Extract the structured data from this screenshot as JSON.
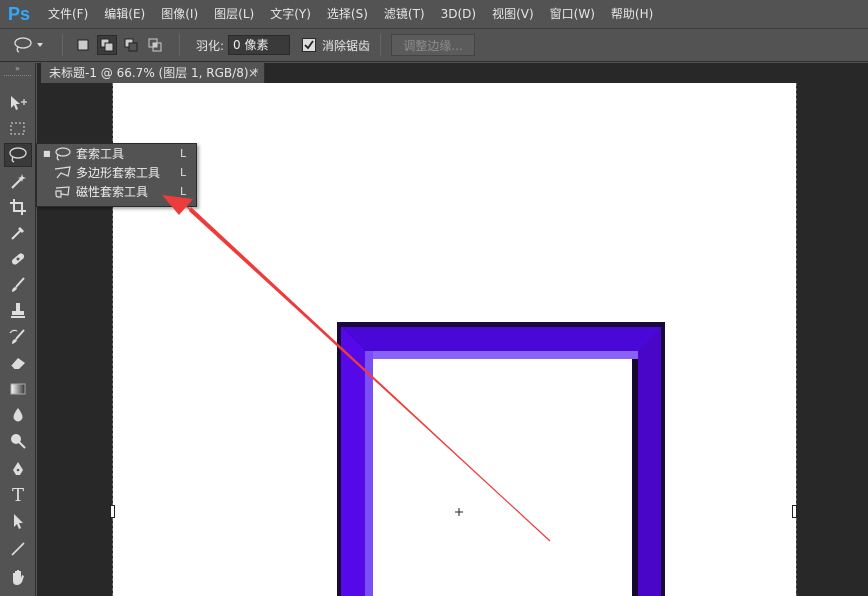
{
  "app": {
    "logo": "Ps"
  },
  "menu": [
    "文件(F)",
    "编辑(E)",
    "图像(I)",
    "图层(L)",
    "文字(Y)",
    "选择(S)",
    "滤镜(T)",
    "3D(D)",
    "视图(V)",
    "窗口(W)",
    "帮助(H)"
  ],
  "options": {
    "feather_label": "羽化:",
    "feather_value": "0 像素",
    "antialias_label": "消除锯齿",
    "antialias_checked": true,
    "refine_label": "调整边缘..."
  },
  "document": {
    "tab_title": "未标题-1 @ 66.7% (图层 1, RGB/8) *",
    "close_glyph": "×"
  },
  "flyout": {
    "items": [
      {
        "label": "套索工具",
        "shortcut": "L",
        "selected": true,
        "icon": "lasso-icon"
      },
      {
        "label": "多边形套索工具",
        "shortcut": "L",
        "selected": false,
        "icon": "polygonal-lasso-icon"
      },
      {
        "label": "磁性套索工具",
        "shortcut": "L",
        "selected": false,
        "icon": "magnetic-lasso-icon"
      }
    ],
    "bullet": "■"
  },
  "tools": [
    "move-tool-icon",
    "marquee-tool-icon",
    "lasso-tool-icon",
    "magic-wand-icon",
    "crop-icon",
    "eyedropper-icon",
    "healing-brush-icon",
    "brush-icon",
    "clone-stamp-icon",
    "history-brush-icon",
    "eraser-icon",
    "gradient-icon",
    "blur-icon",
    "dodge-icon",
    "pen-icon",
    "type-icon",
    "path-selection-icon",
    "line-icon",
    "hand-icon"
  ],
  "type_tool_glyph": "T",
  "colors": {
    "frame_purple": "#5a0bf0",
    "frame_light": "#8a63f5",
    "frame_dark": "#1a0a3a",
    "arrow_red": "#ee3b3b",
    "ui_bg": "#535353",
    "pasteboard": "#282828"
  }
}
